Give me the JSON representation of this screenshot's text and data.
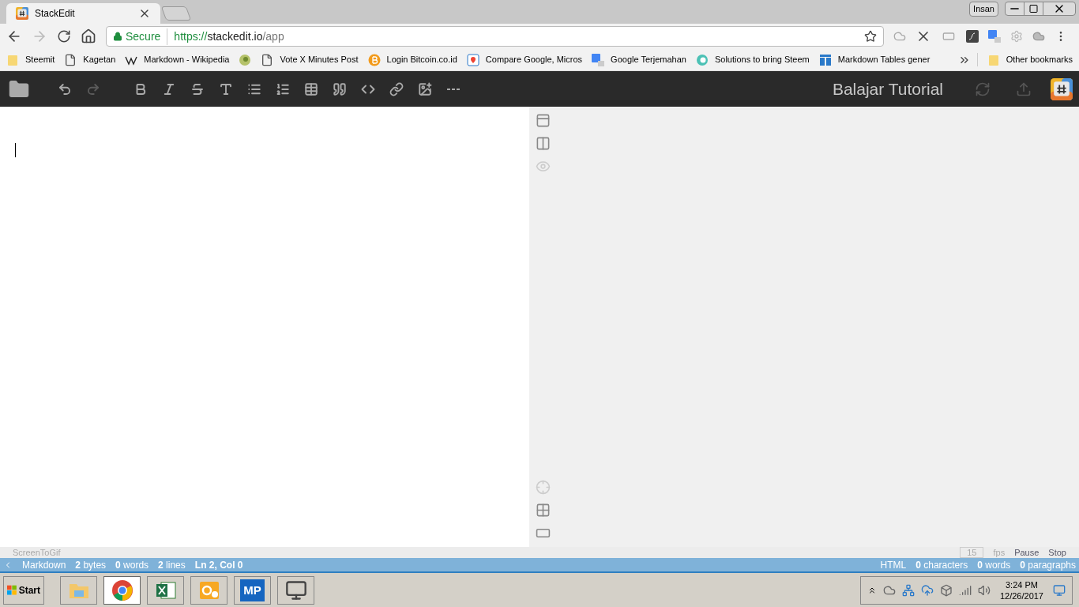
{
  "browser": {
    "tabs": [
      {
        "label": "StackEdit",
        "selected": true
      }
    ],
    "profile": "Insan",
    "address": {
      "security": "Secure",
      "scheme": "https://",
      "host": "stackedit.io",
      "path": "/app"
    }
  },
  "bookmarks": [
    {
      "kind": "folder",
      "label": "Steemit"
    },
    {
      "kind": "page",
      "label": "Kagetan"
    },
    {
      "kind": "wiki",
      "label": "Markdown - Wikipedia"
    },
    {
      "kind": "bird"
    },
    {
      "kind": "page",
      "label": "Vote X Minutes Post"
    },
    {
      "kind": "coin",
      "label": "Login Bitcoin.co.id"
    },
    {
      "kind": "pin",
      "label": "Compare Google, Micros"
    },
    {
      "kind": "translate",
      "label": "Google Terjemahan"
    },
    {
      "kind": "chat",
      "label": "Solutions to bring Steem"
    },
    {
      "kind": "table",
      "label": "Markdown Tables gener"
    }
  ],
  "other_bookmarks": "Other bookmarks",
  "app": {
    "title": "Balajar Tutorial",
    "toolbar": [
      {
        "disabled": false
      },
      {
        "disabled": false
      },
      {
        "disabled": true
      },
      {
        "disabled": false
      },
      {
        "disabled": false
      },
      {
        "disabled": false
      },
      {
        "disabled": false
      },
      {
        "disabled": false
      },
      {
        "disabled": false
      },
      {
        "disabled": false
      },
      {
        "disabled": false
      },
      {
        "disabled": false
      },
      {
        "disabled": false
      },
      {
        "disabled": false
      },
      {
        "disabled": false
      }
    ],
    "sync_disabled": true,
    "publish_disabled": true
  },
  "recorder": {
    "title": "ScreenToGif",
    "fps_value": "15",
    "fps_label": "fps",
    "pause": "Pause",
    "stop": "Stop"
  },
  "status_bar": {
    "left": [
      "Markdown",
      "**2** bytes",
      "**0** words",
      "**2** lines",
      "**Ln 2, Col 0**"
    ],
    "right": [
      "HTML",
      "**0** characters",
      "**0** words",
      "**0** paragraphs"
    ]
  },
  "taskbar": {
    "start": "Start",
    "apps": [
      {
        "kind": "folder",
        "selected": false
      },
      {
        "kind": "chrome",
        "selected": true
      },
      {
        "kind": "excel",
        "selected": false
      },
      {
        "kind": "outlook",
        "selected": false
      },
      {
        "kind": "mp",
        "label": "MP",
        "selected": false
      },
      {
        "kind": "monitor",
        "selected": false
      }
    ],
    "time": "3:24 PM",
    "date": "12/26/2017"
  }
}
